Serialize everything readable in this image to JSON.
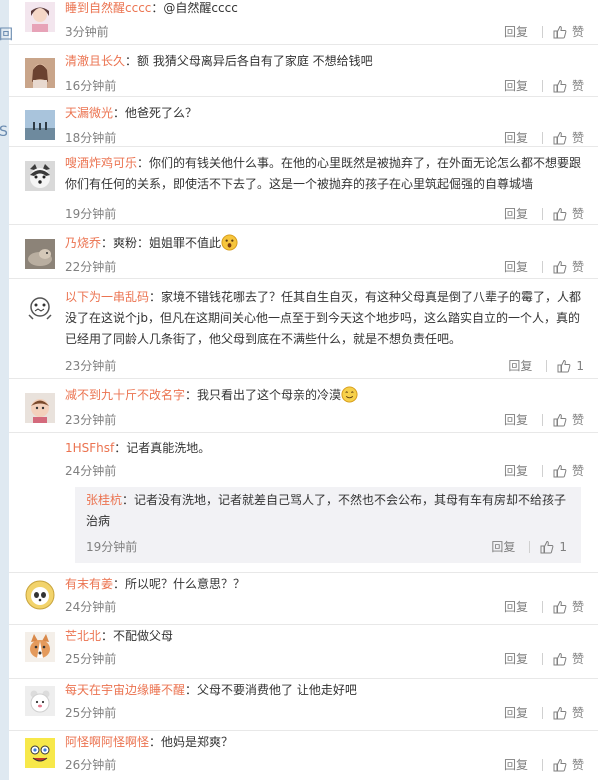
{
  "reply_label": "回复",
  "like_label": "赞",
  "edge_glyphs": [
    "回",
    "S"
  ],
  "comments": [
    {
      "user": "睡到自然醒cccc",
      "text": "：@自然醒cccc",
      "time": "3分钟前",
      "avatar": "girl-avatar",
      "likes": ""
    },
    {
      "user": "清澈且长久",
      "text": "：额 我猜父母离异后各自有了家庭 不想给钱吧",
      "time": "16分钟前",
      "avatar": "woman-avatar",
      "likes": ""
    },
    {
      "user": "天漏微光",
      "text": "：他爸死了么？",
      "time": "18分钟前",
      "avatar": "landscape-avatar",
      "likes": ""
    },
    {
      "user": "嗖酒炸鸡可乐",
      "text": "：你们的有钱关他什么事。在他的心里既然是被抛弃了，在外面无论怎么都不想要跟你们有任何的关系，即使活不下去了。这是一个被抛弃的孩子在心里筑起倔强的自尊城墙",
      "time": "19分钟前",
      "avatar": "dog-avatar",
      "likes": ""
    },
    {
      "user": "乃烧乔",
      "text": "：爽粉：姐姐罪不值此",
      "time": "22分钟前",
      "avatar": "cat-avatar",
      "likes": "",
      "emoji": "surprised-emoji"
    },
    {
      "user": "以下为一串乱码",
      "text": "：家境不错钱花哪去了？任其自生自灭，有这种父母真是倒了八辈子的霉了，人都没了在这说个jb，但凡在这期间关心他一点至于到今天这个地步吗，这么踏实自立的一个人，真的已经用了同龄人几条街了，他父母到底在不满些什么，就是不想负责任吧。",
      "time": "23分钟前",
      "avatar": "cartoon-avatar",
      "likes": "1"
    },
    {
      "user": "减不到九十斤不改名字",
      "text": "：我只看出了这个母亲的冷漠",
      "time": "23分钟前",
      "avatar": "baby-avatar",
      "likes": "",
      "emoji": "smile-emoji"
    },
    {
      "user": "1HSFhsf",
      "text": "：记者真能洗地。",
      "time": "24分钟前",
      "avatar": "",
      "likes": ""
    },
    {
      "user": "有末有姜",
      "text": "：所以呢？什么意思？？",
      "time": "24分钟前",
      "avatar": "panda-avatar",
      "likes": ""
    },
    {
      "user": "芒北北",
      "text": "：不配做父母",
      "time": "25分钟前",
      "avatar": "corgi-avatar",
      "likes": ""
    },
    {
      "user": "每天在宇宙边缘睡不醒",
      "text": "：父母不要消费他了 让他走好吧",
      "time": "25分钟前",
      "avatar": "bear-avatar",
      "likes": ""
    },
    {
      "user": "阿怪啊阿怪啊怪",
      "text": "：他妈是郑爽？",
      "time": "26分钟前",
      "avatar": "sponge-avatar",
      "likes": ""
    }
  ],
  "sub_reply": {
    "user": "张桂杭",
    "text": "：记者没有洗地，记者就差自己骂人了，不然也不会公布，其母有车有房却不给孩子治病",
    "time": "19分钟前",
    "likes": "1"
  }
}
